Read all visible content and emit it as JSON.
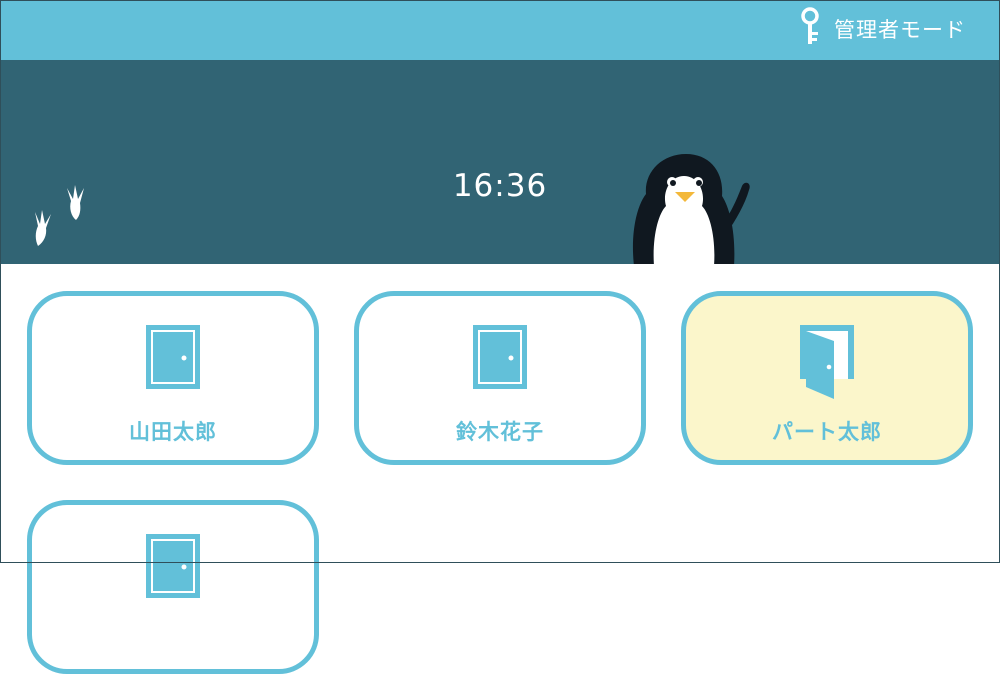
{
  "header": {
    "admin_mode_label": "管理者モード",
    "admin_icon": "key-icon"
  },
  "hero": {
    "time": "16:36",
    "mascot": "penguin-mascot",
    "decoration": "footprints-icon"
  },
  "users": [
    {
      "name": "山田太郎",
      "status": "closed-door",
      "selected": false
    },
    {
      "name": "鈴木花子",
      "status": "closed-door",
      "selected": false
    },
    {
      "name": "パート太郎",
      "status": "open-door",
      "selected": true
    },
    {
      "name": "",
      "status": "closed-door",
      "selected": false
    }
  ],
  "colors": {
    "topbar": "#62c0d9",
    "hero": "#316474",
    "accent": "#62c0d9",
    "selected_card": "#fbf6cb"
  }
}
